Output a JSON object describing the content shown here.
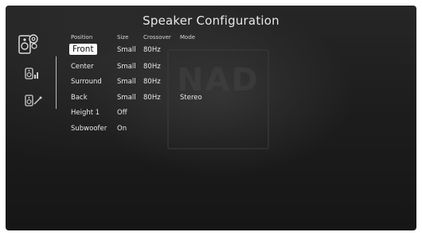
{
  "screen": {
    "title": "Speaker Configuration",
    "watermark": "NAD"
  },
  "sidebar": {
    "items": [
      {
        "name": "speaker-configuration",
        "icon": "speakers-gear-icon"
      },
      {
        "name": "speaker-levels",
        "icon": "speaker-levels-icon"
      },
      {
        "name": "speaker-distance",
        "icon": "speaker-distance-icon"
      }
    ]
  },
  "table": {
    "headers": [
      "Position",
      "Size",
      "Crossover",
      "Mode"
    ],
    "rows": [
      {
        "position": "Front",
        "size": "Small",
        "crossover": "80Hz",
        "mode": ""
      },
      {
        "position": "Center",
        "size": "Small",
        "crossover": "80Hz",
        "mode": ""
      },
      {
        "position": "Surround",
        "size": "Small",
        "crossover": "80Hz",
        "mode": ""
      },
      {
        "position": "Back",
        "size": "Small",
        "crossover": "80Hz",
        "mode": "Stereo"
      },
      {
        "position": "Height 1",
        "size": "Off",
        "crossover": "",
        "mode": ""
      },
      {
        "position": "Subwoofer",
        "size": "On",
        "crossover": "",
        "mode": ""
      }
    ],
    "selected_row": 0
  },
  "colors": {
    "background": "#1d1d1d",
    "text": "#eaeaea",
    "selection": "#ffffff"
  }
}
